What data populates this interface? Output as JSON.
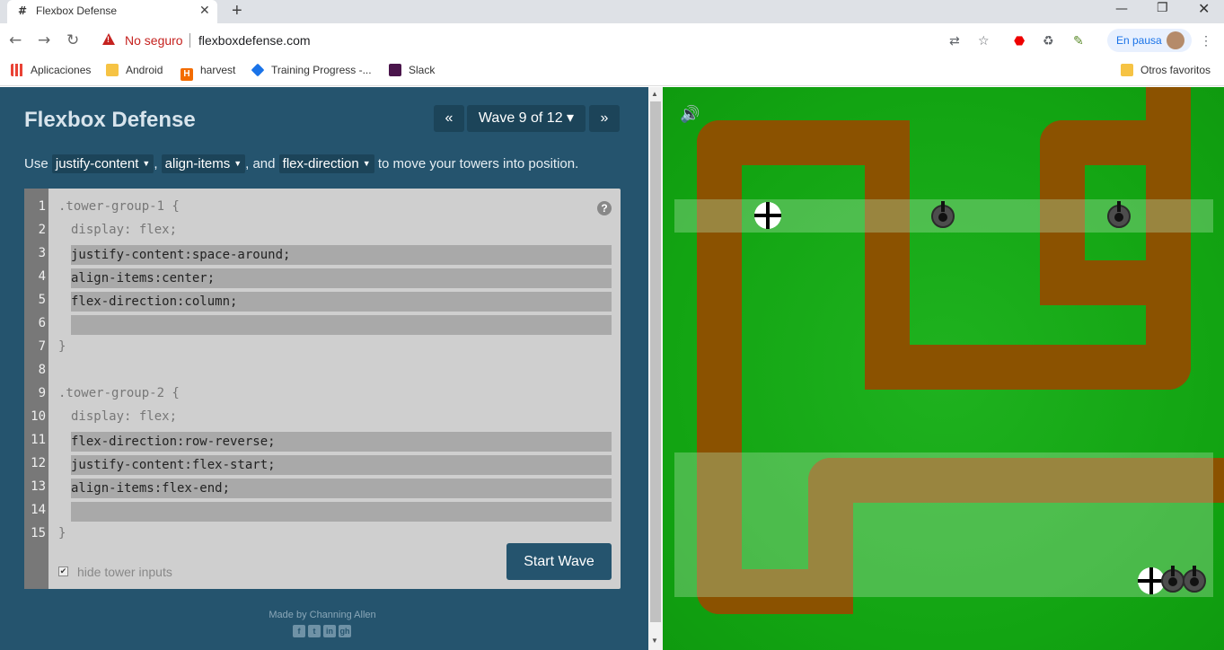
{
  "browser": {
    "tab_title": "Flexbox Defense",
    "tab_favicon": "#",
    "security_label": "No seguro",
    "url": "flexboxdefense.com",
    "profile_status": "En pausa",
    "bookmarks": [
      "Aplicaciones",
      "Android",
      "harvest",
      "Training Progress -...",
      "Slack"
    ],
    "other_bookmarks": "Otros favoritos",
    "icons": [
      "translate-icon",
      "star-icon",
      "adblock-icon",
      "recycle-icon",
      "dropper-icon"
    ]
  },
  "game": {
    "title": "Flexbox Defense",
    "prev_label": "«",
    "wave_label": "Wave 9 of 12",
    "wave_caret": "▾",
    "next_label": "»",
    "instruction": {
      "use": "Use",
      "prop1": "justify-content",
      "comma": ",",
      "prop2": "align-items",
      "and": ", and",
      "prop3": "flex-direction",
      "tail": "to move your towers into position."
    },
    "editor": {
      "line_numbers": [
        "1",
        "2",
        "3",
        "4",
        "5",
        "6",
        "7",
        "8",
        "9",
        "10",
        "11",
        "12",
        "13",
        "14",
        "15"
      ],
      "group1_open": ".tower-group-1 {",
      "group1_display": "display: flex;",
      "group1_inputs": [
        "justify-content:space-around;",
        "align-items:center;",
        "flex-direction:column;",
        ""
      ],
      "group1_close": "}",
      "group2_open": ".tower-group-2 {",
      "group2_display": "display: flex;",
      "group2_inputs": [
        "flex-direction:row-reverse;",
        "justify-content:flex-start;",
        "align-items:flex-end;",
        ""
      ],
      "group2_close": "}",
      "help": "?"
    },
    "start_button": "Start Wave",
    "hide_inputs_label": "hide tower inputs",
    "hide_inputs_checked": "✔",
    "credits": "Made by Channing Allen",
    "social": [
      "f",
      "t",
      "in",
      "gh"
    ]
  },
  "colors": {
    "panel": "#25546e",
    "board": "#12a412",
    "path": "#8b5200"
  }
}
